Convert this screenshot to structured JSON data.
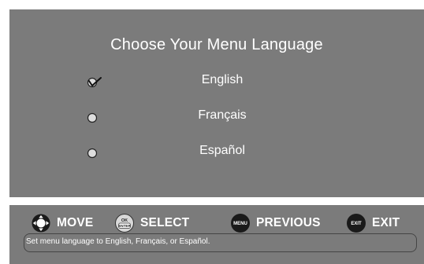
{
  "menu": {
    "title": "Choose Your Menu Language",
    "selected_index": 0,
    "options": [
      {
        "label": "English",
        "selected": true
      },
      {
        "label": "Français",
        "selected": false
      },
      {
        "label": "Español",
        "selected": false
      }
    ]
  },
  "controls": {
    "move": {
      "label": "MOVE",
      "icon": "dpad-icon"
    },
    "select": {
      "label": "SELECT",
      "icon": "ok-enter-button-icon",
      "icon_text_top": "OK",
      "icon_text_bottom": "ENTER"
    },
    "previous": {
      "label": "PREVIOUS",
      "icon": "menu-button-icon",
      "icon_text": "MENU"
    },
    "exit": {
      "label": "EXIT",
      "icon": "exit-button-icon",
      "icon_text": "EXIT"
    }
  },
  "status": {
    "text": "Set menu language to English, Français, or Español."
  },
  "colors": {
    "panel": "#7b7b7b",
    "text": "#ffffff",
    "button_dark": "#1a1a1a"
  }
}
